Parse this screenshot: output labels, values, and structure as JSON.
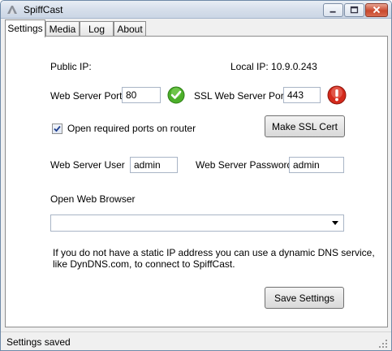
{
  "window": {
    "title": "SpiffCast"
  },
  "tabs": [
    {
      "label": "Settings"
    },
    {
      "label": "Media"
    },
    {
      "label": "Log"
    },
    {
      "label": "About"
    }
  ],
  "settings": {
    "public_ip_label": "Public IP:",
    "local_ip_label": "Local IP: 10.9.0.243",
    "web_server_port_label": "Web Server Port",
    "web_server_port_value": "80",
    "ssl_port_label": "SSL Web Server Port",
    "ssl_port_value": "443",
    "open_ports_label": "Open required ports on router",
    "open_ports_checked": true,
    "make_ssl_label": "Make SSL Cert",
    "user_label": "Web Server User",
    "user_value": "admin",
    "password_label": "Web Server Password",
    "password_value": "admin",
    "browser_label": "Open Web Browser",
    "browser_value": "",
    "dns_note_line1": "If you do not have a static IP address you can use a dynamic DNS service,",
    "dns_note_line2": "like DynDNS.com, to connect to SpiffCast.",
    "save_label": "Save Settings"
  },
  "status": {
    "text": "Settings saved"
  },
  "icons": {
    "port_ok": "green-check-icon",
    "ssl_error": "red-exclamation-icon"
  },
  "colors": {
    "ok": "#4caf2a",
    "error": "#d42a1c"
  }
}
